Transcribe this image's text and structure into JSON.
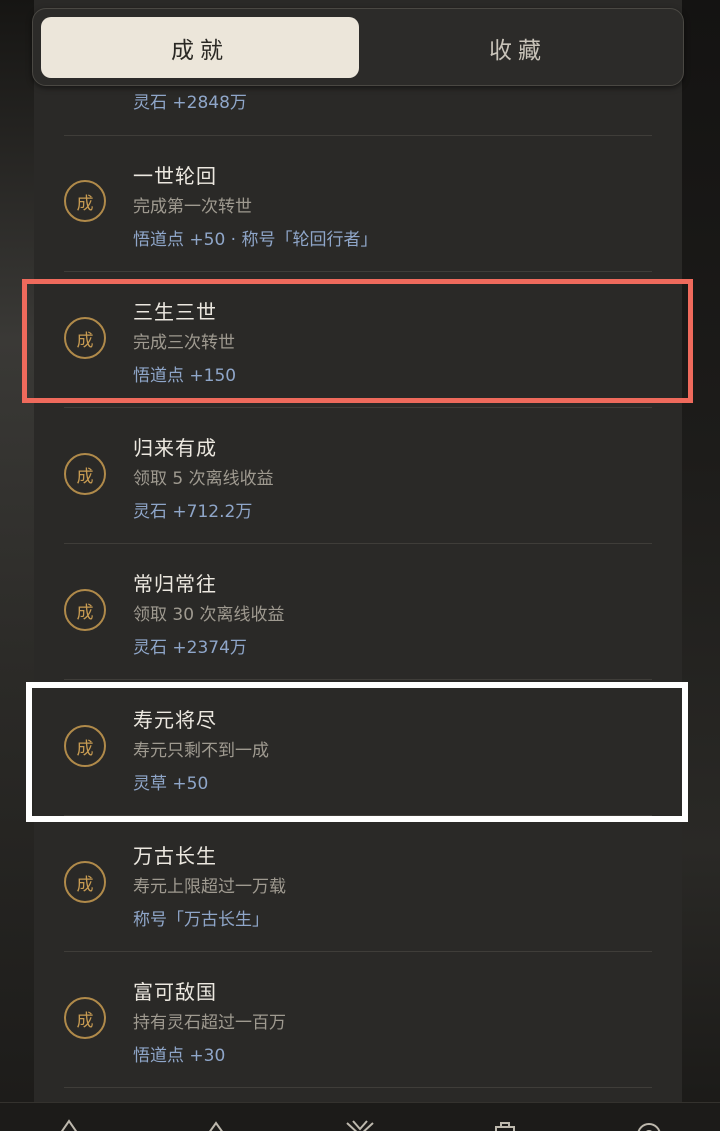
{
  "tabs": {
    "achievements": "成就",
    "collection": "收藏"
  },
  "partial_item": {
    "reward": "灵石 +2848万"
  },
  "badge_char": "成",
  "items": [
    {
      "title": "一世轮回",
      "desc": "完成第一次转世",
      "reward": "悟道点 +50 · 称号「轮回行者」"
    },
    {
      "title": "三生三世",
      "desc": "完成三次转世",
      "reward": "悟道点 +150"
    },
    {
      "title": "归来有成",
      "desc": "领取 5 次离线收益",
      "reward": "灵石 +712.2万"
    },
    {
      "title": "常归常往",
      "desc": "领取 30 次离线收益",
      "reward": "灵石 +2374万"
    },
    {
      "title": "寿元将尽",
      "desc": "寿元只剩不到一成",
      "reward": "灵草 +50"
    },
    {
      "title": "万古长生",
      "desc": "寿元上限超过一万载",
      "reward": "称号「万古长生」"
    },
    {
      "title": "富可敌国",
      "desc": "持有灵石超过一百万",
      "reward": "悟道点 +30"
    }
  ],
  "bottom_nav": [
    "mountain-icon",
    "peak-icon",
    "butterfly-icon",
    "bag-icon",
    "settings-icon"
  ]
}
